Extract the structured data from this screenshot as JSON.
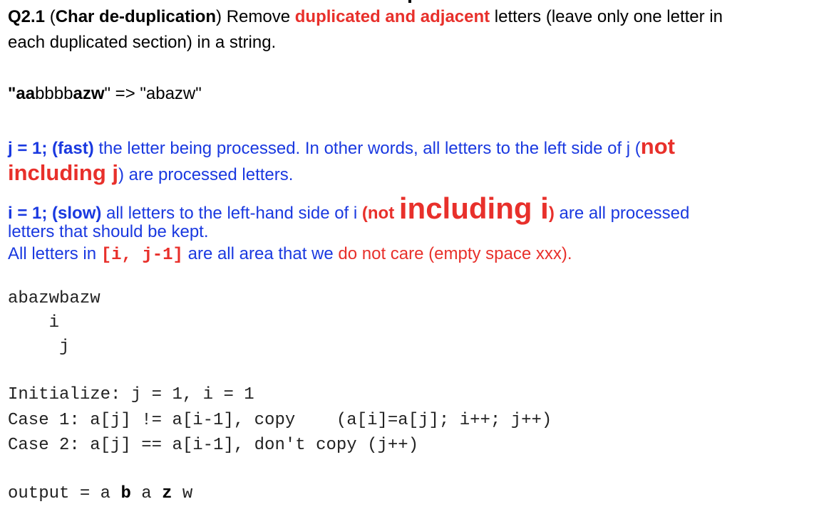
{
  "q": {
    "num": "Q2.1",
    "open": " (",
    "title": "Char de-duplication",
    "close": ")",
    "remove": " Remove ",
    "emph": "duplicated and adjacent",
    "rest1": " letters (leave only one letter in",
    "rest2": "each duplicated section) in a string."
  },
  "example": {
    "q1": "\"aa",
    "q2": "bbbb",
    "q3": "azw",
    "q4": "\" => \"abazw\""
  },
  "j": {
    "label": "j = 1; (fast)",
    "text": "  the letter being processed. In other words, all letters to the left side of j (",
    "not": "not",
    "including": "including j",
    "rest": ") are processed letters."
  },
  "i": {
    "label": "i = 1; (slow)",
    "text": "  all letters to the left-hand side of i ",
    "paren": "(not ",
    "including": "including i",
    "close": ")",
    "rest1": "  are all processed",
    "rest2": "letters that should be kept."
  },
  "all": {
    "t1": "All letters in  ",
    "range": "[i, j-1]",
    "t2": "  are all area that we ",
    "care": "do not care (empty space xxx)."
  },
  "trace": {
    "row1": "abazwbazw",
    "row2": "    i",
    "row3": "     j"
  },
  "code": {
    "init": "Initialize: j = 1, i = 1",
    "case1": "Case 1: a[j] != a[i-1], copy    (a[i]=a[j]; i++; j++)",
    "case2": "Case 2: a[j] == a[i-1], don't copy (j++)"
  },
  "output": {
    "label": "output = a ",
    "b": "b",
    "mid": " a ",
    "z": "z",
    "end": " w"
  }
}
